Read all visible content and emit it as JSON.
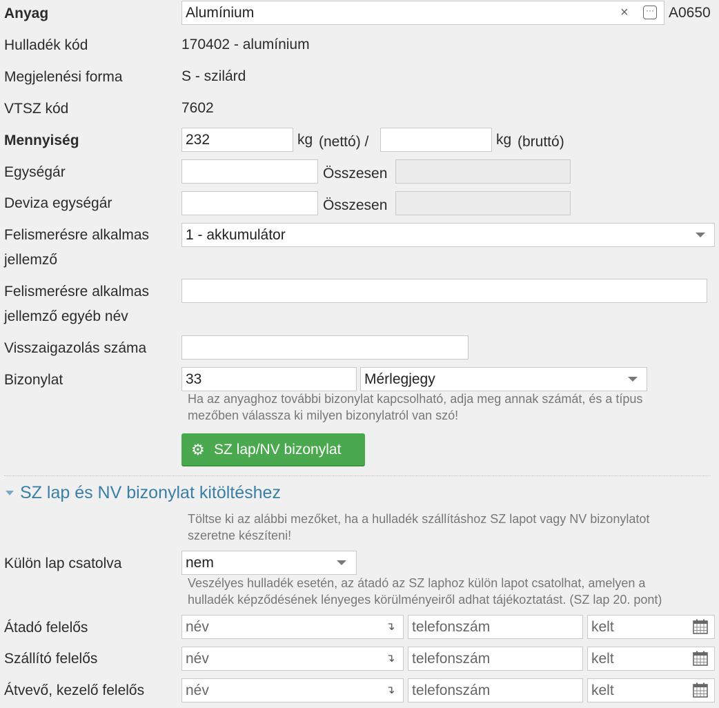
{
  "anyag": {
    "label": "Anyag",
    "value": "Alumínium",
    "code": "A0650",
    "clear_symbol": "×",
    "more_symbol": "···"
  },
  "hulladek_kod": {
    "label": "Hulladék kód",
    "value": "170402 - alumínium"
  },
  "megjelenesi_forma": {
    "label": "Megjelenési forma",
    "value": "S - szilárd"
  },
  "vtsz_kod": {
    "label": "VTSZ kód",
    "value": "7602"
  },
  "mennyiseg": {
    "label": "Mennyiség",
    "netto_value": "232",
    "unit": "kg",
    "netto_text": "(nettó) /",
    "brutto_value": "",
    "brutto_text": "(bruttó)"
  },
  "egysegar": {
    "label": "Egységár",
    "value": "",
    "osszesen_label": "Összesen",
    "osszesen_value": ""
  },
  "deviza_egysegar": {
    "label": "Deviza egységár",
    "value": "",
    "osszesen_label": "Összesen",
    "osszesen_value": ""
  },
  "felismeres": {
    "label_line1": "Felismerésre alkalmas",
    "label_line2": "jellemző",
    "selected": "1 - akkumulátor"
  },
  "felismeres_egyeb": {
    "label_line1": "Felismerésre alkalmas",
    "label_line2": "jellemző egyéb név",
    "value": ""
  },
  "visszaigazolas": {
    "label": "Visszaigazolás száma",
    "value": ""
  },
  "bizonylat": {
    "label": "Bizonylat",
    "number": "33",
    "type_selected": "Mérlegjegy",
    "hint_line1": "Ha az anyaghoz további bizonylat kapcsolható, adja meg annak számát, és a típus",
    "hint_line2": "mezőben válassza ki milyen bizonylatról van szó!"
  },
  "sz_button": {
    "label": "SZ lap/NV bizonylat",
    "icon": "gear-icon",
    "color": "#4aa94f"
  },
  "section": {
    "title": "SZ lap és NV bizonylat kitöltéshez",
    "hint_line1": "Töltse ki az alábbi mezőket, ha a hulladék szállításhoz SZ lapot vagy NV bizonylatot",
    "hint_line2": "szeretne készíteni!",
    "color": "#3a7fa6"
  },
  "kulon_lap": {
    "label": "Külön lap csatolva",
    "selected": "nem",
    "hint_line1": "Veszélyes hulladék esetén, az átadó az SZ laphoz külön lapot csatolhat, amelyen a",
    "hint_line2": "hulladék képződésének lényeges körülményeiről adhat tájékoztatást. (SZ lap 20. pont)"
  },
  "felelosok": [
    {
      "label": "Átadó felelős",
      "name_placeholder": "név",
      "phone_placeholder": "telefonszám",
      "date_placeholder": "kelt"
    },
    {
      "label": "Szállító felelős",
      "name_placeholder": "név",
      "phone_placeholder": "telefonszám",
      "date_placeholder": "kelt"
    },
    {
      "label": "Átvevő, kezelő felelős",
      "name_placeholder": "név",
      "phone_placeholder": "telefonszám",
      "date_placeholder": "kelt"
    }
  ],
  "row_arrow_symbol": "↴"
}
